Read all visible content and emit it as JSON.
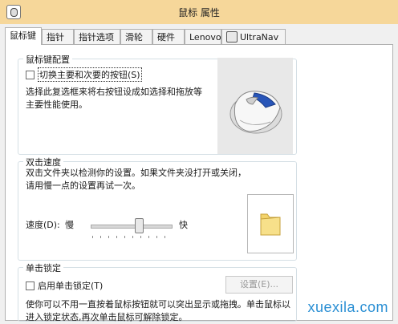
{
  "window": {
    "title": "鼠标 属性"
  },
  "tabs": [
    {
      "label": "鼠标键"
    },
    {
      "label": "指针"
    },
    {
      "label": "指针选项"
    },
    {
      "label": "滑轮"
    },
    {
      "label": "硬件"
    },
    {
      "label": "Lenovo"
    },
    {
      "label": "UltraNav"
    }
  ],
  "button_config": {
    "title": "鼠标键配置",
    "swap_label": "切换主要和次要的按钮(S)",
    "swap_checked": false,
    "description": "选择此复选框来将右按钮设成如选择和拖放等主要性能使用。"
  },
  "double_click": {
    "title": "双击速度",
    "description": "双击文件夹以检测你的设置。如果文件夹没打开或关闭，请用慢一点的设置再试一次。",
    "speed_label": "速度(D):",
    "slow_label": "慢",
    "fast_label": "快",
    "speed_fraction": 0.6
  },
  "click_lock": {
    "title": "单击锁定",
    "enable_label": "启用单击锁定(T)",
    "enable_checked": false,
    "settings_button": "设置(E)...",
    "description": "使你可以不用一直按着鼠标按钮就可以突出显示或拖拽。单击鼠标以进入锁定状态,再次单击鼠标可解除锁定。"
  },
  "watermark": "xuexila.com",
  "colors": {
    "titlebar": "#f6d79a",
    "watermark": "#2a8fd4"
  }
}
